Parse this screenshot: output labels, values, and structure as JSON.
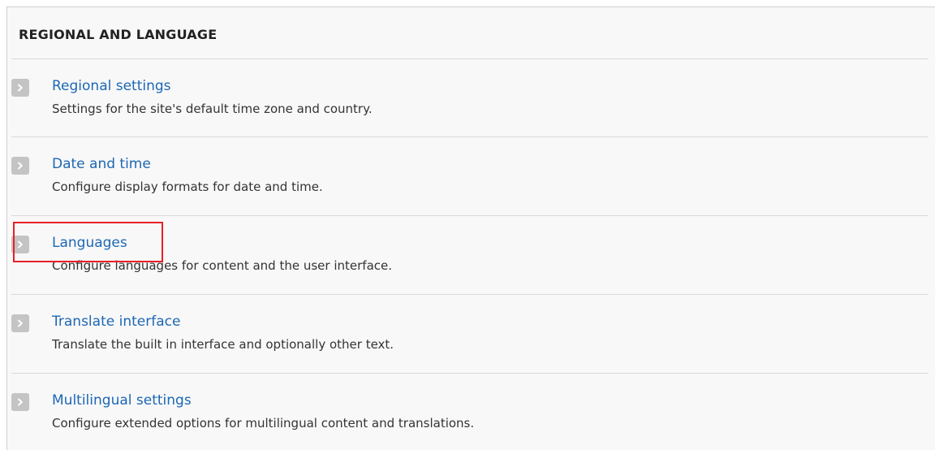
{
  "section": {
    "title": "REGIONAL AND LANGUAGE"
  },
  "items": [
    {
      "label": "Regional settings",
      "description": "Settings for the site's default time zone and country."
    },
    {
      "label": "Date and time",
      "description": "Configure display formats for date and time."
    },
    {
      "label": "Languages",
      "description": "Configure languages for content and the user interface."
    },
    {
      "label": "Translate interface",
      "description": "Translate the built in interface and optionally other text."
    },
    {
      "label": "Multilingual settings",
      "description": "Configure extended options for multilingual content and translations."
    }
  ],
  "icons": {
    "item_icon": "chevron-right-icon"
  },
  "colors": {
    "link": "#1d67b4",
    "highlight": "#e8202a",
    "icon_bg": "#c4c4c4",
    "panel_bg": "#f8f8f8"
  }
}
